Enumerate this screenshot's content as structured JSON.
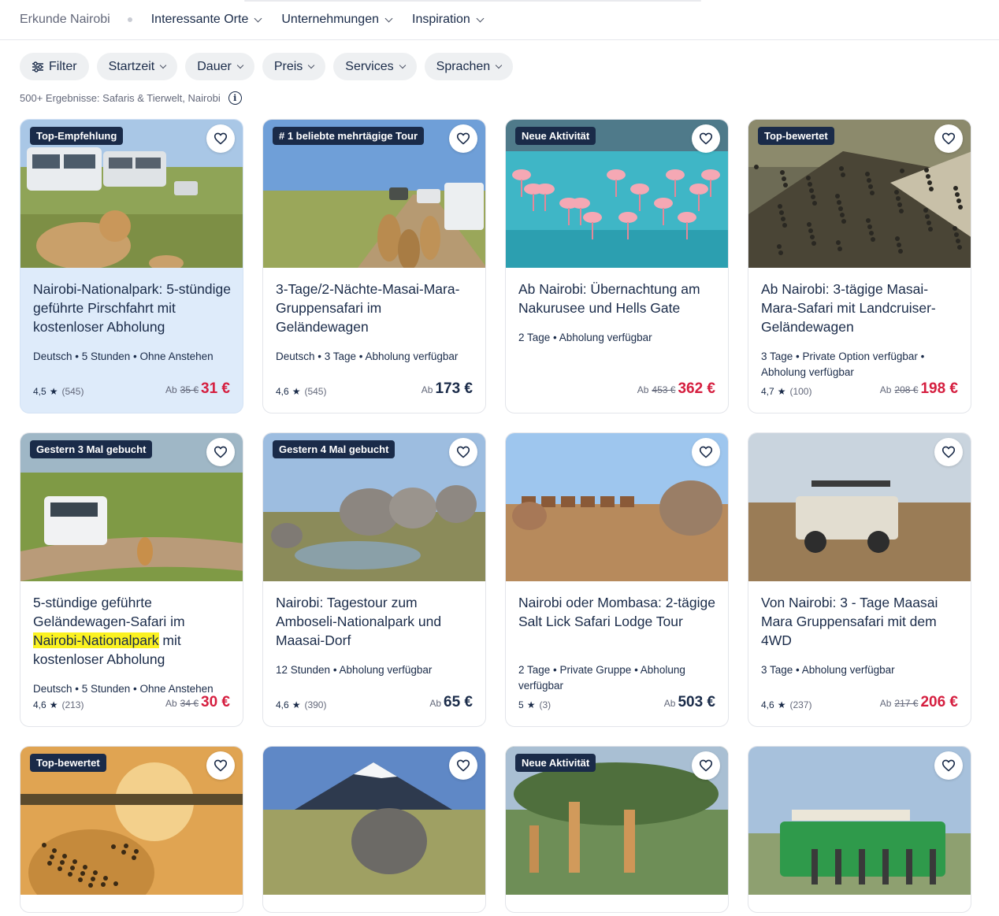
{
  "nav": {
    "explore": "Erkunde Nairobi",
    "items": [
      "Interessante Orte",
      "Unternehmungen",
      "Inspiration"
    ]
  },
  "filters": {
    "filter_label": "Filter",
    "dropdowns": [
      "Startzeit",
      "Dauer",
      "Preis",
      "Services",
      "Sprachen"
    ]
  },
  "results_text": "500+ Ergebnisse: Safaris & Tierwelt, Nairobi",
  "info_glyph": "i",
  "colors": {
    "sale": "#d51e3f",
    "badge": "#1a2b49",
    "highlight_card": "#deebfa",
    "text_highlight": "#fbf221"
  },
  "cards": [
    {
      "badge": "Top-Empfehlung",
      "title": "Nairobi-Nationalpark: 5-stündige geführte Pirschfahrt mit kostenloser Abholung",
      "meta": "Deutsch • 5 Stunden • Ohne Anstehen",
      "rating": "4,5",
      "reviews": "(545)",
      "prefix": "Ab",
      "old_price": "35 €",
      "price": "31 €",
      "sale": true,
      "image": "lions-and-safari-vans"
    },
    {
      "badge": "# 1 beliebte mehrtägige Tour",
      "title": "3-Tage/2-Nächte-Masai-Mara-Gruppensafari im Geländewagen",
      "meta": "Deutsch • 3 Tage • Abholung verfügbar",
      "rating": "4,6",
      "reviews": "(545)",
      "prefix": "Ab",
      "old_price": "",
      "price": "173 €",
      "sale": false,
      "image": "lions-on-road"
    },
    {
      "badge": "Neue Aktivität",
      "title": "Ab Nairobi: Übernachtung am Nakurusee und Hells Gate",
      "meta": "2 Tage • Abholung verfügbar",
      "rating": "",
      "reviews": "",
      "prefix": "Ab",
      "old_price": "453 €",
      "price": "362 €",
      "sale": true,
      "image": "flamingos"
    },
    {
      "badge": "Top-bewertet",
      "title": "Ab Nairobi: 3-tägige Masai-Mara-Safari mit Landcruiser-Geländewagen",
      "meta": "3 Tage • Private Option verfügbar • Abholung verfügbar",
      "rating": "4,7",
      "reviews": "(100)",
      "prefix": "Ab",
      "old_price": "208 €",
      "price": "198 €",
      "sale": true,
      "image": "wildebeest-migration"
    },
    {
      "badge": "Gestern 3 Mal gebucht",
      "title_pre": "5-stündige geführte Geländewagen-Safari im ",
      "title_mark": "Nairobi-Nationalpark",
      "title_post": " mit kostenloser Abholung",
      "meta": "Deutsch • 5 Stunden • Ohne Anstehen",
      "rating": "4,6",
      "reviews": "(213)",
      "prefix": "Ab",
      "old_price": "34 €",
      "price": "30 €",
      "sale": true,
      "image": "safari-van-and-cheetah"
    },
    {
      "badge": "Gestern 4 Mal gebucht",
      "title": "Nairobi: Tagestour zum Amboseli-Nationalpark und Maasai-Dorf",
      "meta": "12 Stunden • Abholung verfügbar",
      "rating": "4,6",
      "reviews": "(390)",
      "prefix": "Ab",
      "old_price": "",
      "price": "65 €",
      "sale": false,
      "image": "elephants-at-water"
    },
    {
      "badge": "",
      "title": "Nairobi oder Mombasa: 2-tägige Salt Lick Safari Lodge Tour",
      "meta": "2 Tage • Private Gruppe • Abholung verfügbar",
      "rating": "5",
      "reviews": "(3)",
      "prefix": "Ab",
      "old_price": "",
      "price": "503 €",
      "sale": false,
      "image": "elephants-and-lodge"
    },
    {
      "badge": "",
      "title": "Von Nairobi: 3 - Tage Maasai Mara Gruppensafari mit dem 4WD",
      "meta": "3 Tage • Abholung verfügbar",
      "rating": "4,6",
      "reviews": "(237)",
      "prefix": "Ab",
      "old_price": "217 €",
      "price": "206 €",
      "sale": true,
      "image": "land-cruiser"
    },
    {
      "badge": "Top-bewertet",
      "image": "leopard-sunset"
    },
    {
      "badge": "",
      "image": "elephant-kilimanjaro"
    },
    {
      "badge": "Neue Aktivität",
      "image": "giraffes"
    },
    {
      "badge": "",
      "image": "group-on-green-jeep"
    }
  ]
}
